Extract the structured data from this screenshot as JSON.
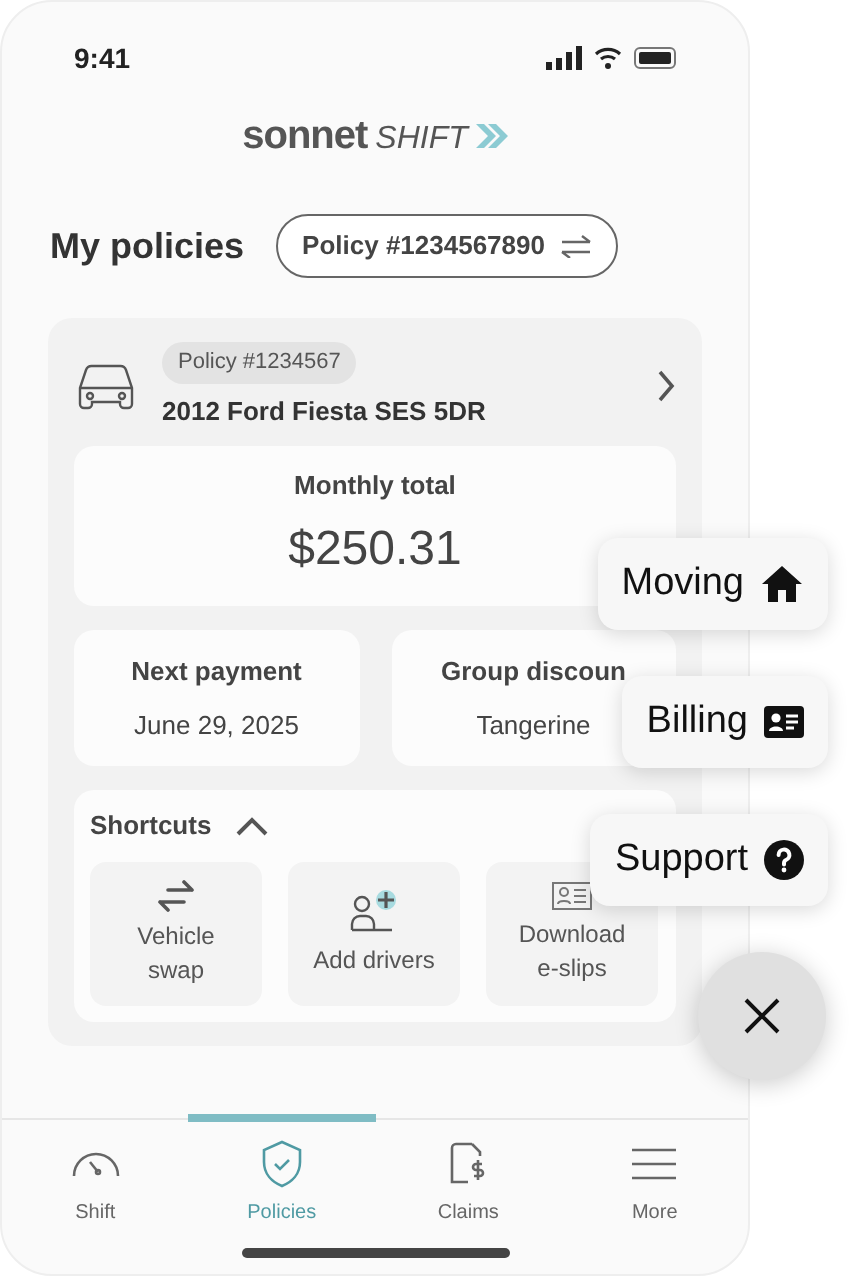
{
  "status_bar": {
    "time": "9:41"
  },
  "logo": {
    "brand": "sonnet",
    "product": "SHIFT"
  },
  "header": {
    "title": "My policies",
    "policy_selector": "Policy #1234567890"
  },
  "policy_card": {
    "policy_badge": "Policy #1234567",
    "vehicle": "2012 Ford Fiesta SES 5DR",
    "monthly_total": {
      "label": "Monthly total",
      "value": "$250.31"
    },
    "next_payment": {
      "label": "Next payment",
      "value": "June 29, 2025"
    },
    "group_discount": {
      "label": "Group discoun",
      "value": "Tangerine"
    },
    "shortcuts": {
      "title": "Shortcuts",
      "expanded": true,
      "items": [
        {
          "kind": "swap",
          "label": "Vehicle swap"
        },
        {
          "kind": "add-driver",
          "label": "Add drivers"
        },
        {
          "kind": "slip",
          "label": "Download e-slips"
        }
      ]
    }
  },
  "fab_menu": {
    "open": true,
    "items": [
      {
        "kind": "home",
        "label": "Moving"
      },
      {
        "kind": "card",
        "label": "Billing"
      },
      {
        "kind": "help",
        "label": "Support"
      }
    ]
  },
  "bottom_nav": [
    {
      "kind": "gauge",
      "label": "Shift",
      "selected": false
    },
    {
      "kind": "shield",
      "label": "Policies",
      "selected": true
    },
    {
      "kind": "claim",
      "label": "Claims",
      "selected": false
    },
    {
      "kind": "menu",
      "label": "More",
      "selected": false
    }
  ]
}
